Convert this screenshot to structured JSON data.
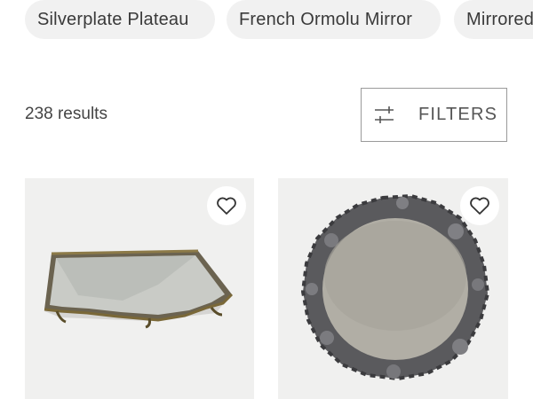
{
  "chips": [
    {
      "label": "Silverplate Plateau"
    },
    {
      "label": "French Ormolu Mirror"
    },
    {
      "label": "Mirrored"
    }
  ],
  "results": {
    "count_text": "238 results"
  },
  "filters": {
    "label": "FILTERS",
    "icon": "sliders-icon"
  },
  "products": [
    {
      "image_desc": "brass-framed mirror plateau",
      "favorite_icon": "heart-icon"
    },
    {
      "image_desc": "round mirror with rough silver frame",
      "favorite_icon": "heart-icon"
    }
  ]
}
